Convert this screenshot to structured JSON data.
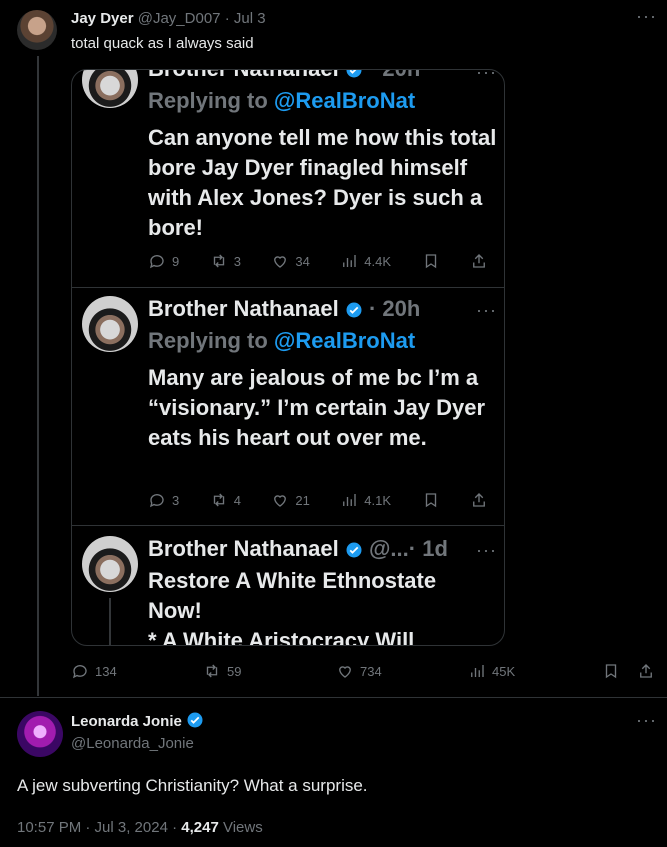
{
  "quote_tweet": {
    "author_name": "Jay Dyer",
    "author_handle": "@Jay_D007",
    "date": "· Jul 3",
    "text": "total quack as I always said",
    "stats": {
      "replies": "134",
      "retweets": "59",
      "likes": "734",
      "views": "45K"
    }
  },
  "embedded": {
    "tweet1": {
      "author_name": "Brother Nathanael",
      "time": "· 20h",
      "reply_prefix": "Replying to",
      "reply_to": "@RealBroNat",
      "text": "Can anyone tell me how this total bore Jay Dyer finagled himself with Alex Jones? Dyer is such a bore!",
      "stats": {
        "replies": "9",
        "retweets": "3",
        "likes": "34",
        "views": "4.4K"
      }
    },
    "tweet2": {
      "author_name": "Brother Nathanael",
      "time": "· 20h",
      "reply_prefix": "Replying to",
      "reply_to": "@RealBroNat",
      "text": "Many are jealous of me bc I’m a “visionary.” I’m certain Jay Dyer eats his heart out over me.",
      "stats": {
        "replies": "3",
        "retweets": "4",
        "likes": "21",
        "views": "4.1K"
      }
    },
    "tweet3": {
      "author_name": "Brother Nathanael",
      "handle_trunc": "@...",
      "time": "· 1d",
      "line1": "Restore A White Ethnostate",
      "line2": "Now!",
      "line3": "* A White Aristocracy Will"
    }
  },
  "reply": {
    "author_name": "Leonarda Jonie",
    "author_handle": "@Leonarda_Jonie",
    "text": "A jew subverting Christianity? What a surprise.",
    "meta_time": "10:57 PM · Jul 3, 2024 ·",
    "views_count": "4,247",
    "views_label": "Views"
  },
  "icons": {
    "more": "more-icon",
    "verified": "verified-badge-icon"
  },
  "colors": {
    "accent": "#1d9bf0",
    "muted": "#71767b",
    "bg": "#000000",
    "border": "#2f3336"
  }
}
